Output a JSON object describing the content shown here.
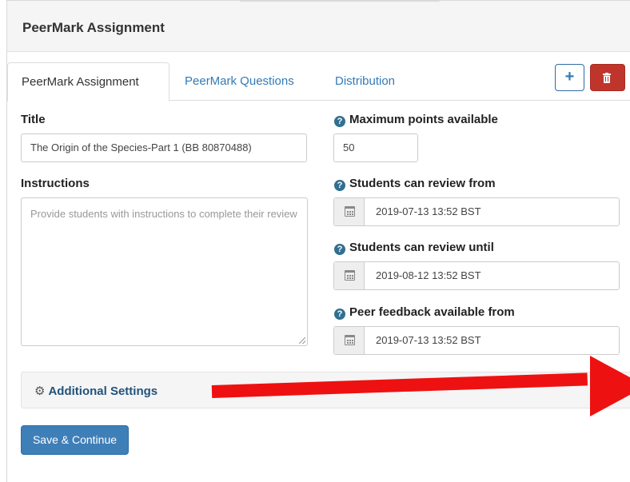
{
  "header": {
    "title": "PeerMark Assignment"
  },
  "tabs": [
    {
      "label": "PeerMark Assignment",
      "active": true
    },
    {
      "label": "PeerMark Questions",
      "active": false
    },
    {
      "label": "Distribution",
      "active": false
    }
  ],
  "toolbar": {
    "add_label": "+",
    "delete_icon": "trash-icon"
  },
  "form": {
    "title_label": "Title",
    "title_value": "The Origin of the Species-Part 1 (BB 80870488)",
    "instructions_label": "Instructions",
    "instructions_placeholder": "Provide students with instructions to complete their review",
    "max_points_label": "Maximum points available",
    "max_points_value": "50",
    "review_from_label": "Students can review from",
    "review_from_value": "2019-07-13 13:52 BST",
    "review_until_label": "Students can review until",
    "review_until_value": "2019-08-12 13:52 BST",
    "feedback_from_label": "Peer feedback available from",
    "feedback_from_value": "2019-07-13 13:52 BST",
    "help_icon": "question-circle-icon",
    "calendar_icon": "calendar-icon"
  },
  "additional_settings": {
    "label": "Additional Settings",
    "icon": "gear-icon"
  },
  "actions": {
    "save_label": "Save & Continue"
  },
  "colors": {
    "link": "#337ab7",
    "primary_button": "#3f7fb8",
    "danger_button": "#c0352b",
    "annotation_arrow": "#ee1111",
    "help_icon": "#31708f"
  }
}
